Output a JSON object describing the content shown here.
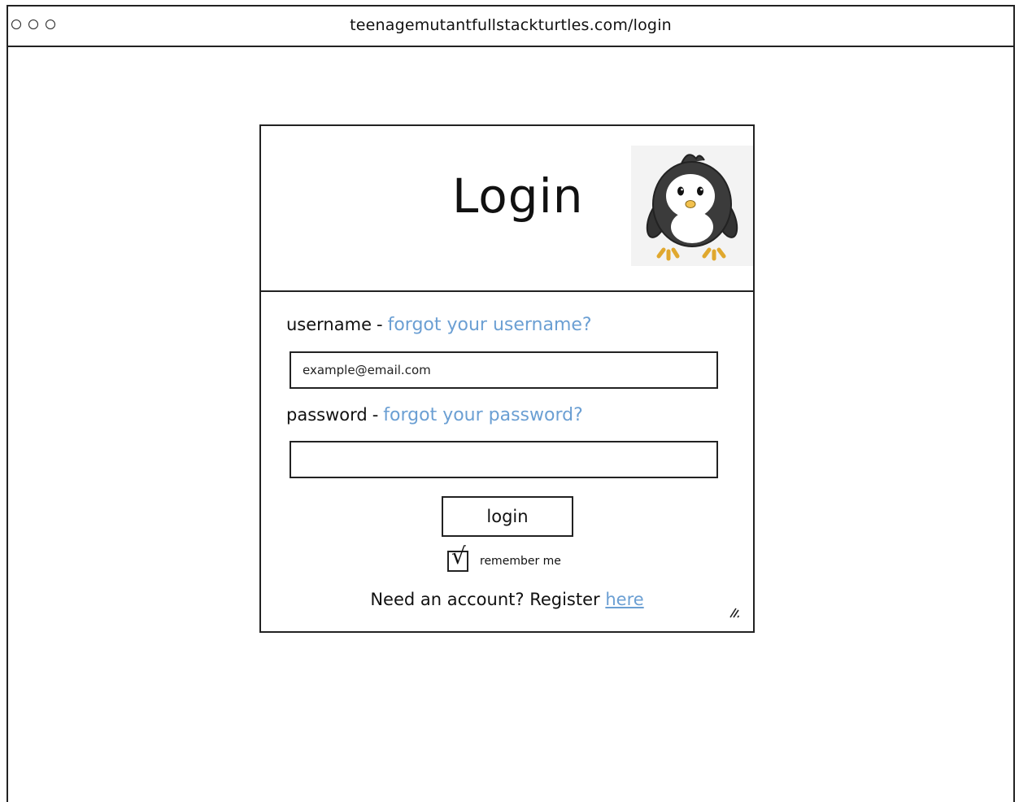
{
  "browser": {
    "url": "teenagemutantfullstackturtles.com/login"
  },
  "login_card": {
    "title": "Login",
    "mascot_icon": "penguin-icon",
    "username": {
      "label": "username",
      "separator": "-",
      "forgot_link": "forgot your username?",
      "placeholder": "example@email.com",
      "value": ""
    },
    "password": {
      "label": "password",
      "separator": "-",
      "forgot_link": "forgot your password?",
      "value": ""
    },
    "login_button_label": "login",
    "remember_me": {
      "label": "remember me",
      "checked": true,
      "check_glyph": "√"
    },
    "register": {
      "prompt": "Need an account? Register",
      "link": "here"
    }
  },
  "colors": {
    "link": "#6b9fd3",
    "ink": "#111111",
    "border": "#222222"
  }
}
